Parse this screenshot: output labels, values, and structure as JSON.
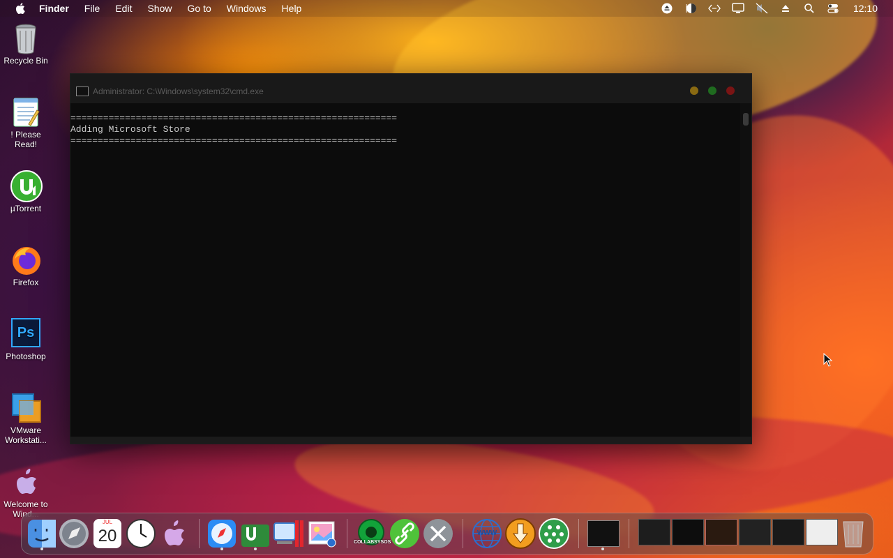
{
  "menubar": {
    "app": "Finder",
    "items": [
      "File",
      "Edit",
      "Show",
      "Go to",
      "Windows",
      "Help"
    ],
    "status_icons": [
      "eject-circle-icon",
      "half-moon-icon",
      "code-arrows-icon",
      "display-icon",
      "mute-icon",
      "eject-icon",
      "search-icon",
      "control-center-icon"
    ],
    "clock": "12:10"
  },
  "desktop": {
    "icons": [
      {
        "label": "Recycle Bin",
        "icon": "recycle-bin-icon"
      },
      {
        "label": "! Please Read!",
        "icon": "notepad-icon"
      },
      {
        "label": "µTorrent",
        "icon": "utorrent-icon"
      },
      {
        "label": "Firefox",
        "icon": "firefox-icon"
      },
      {
        "label": "Photoshop",
        "icon": "photoshop-icon",
        "glyph": "Ps"
      },
      {
        "label": "VMware Workstati...",
        "icon": "vmware-icon"
      },
      {
        "label": "Welcome to Wind...",
        "icon": "welcome-icon"
      }
    ]
  },
  "cmd": {
    "title": "Administrator: C:\\Windows\\system32\\cmd.exe",
    "lines": [
      "============================================================",
      "Adding Microsoft Store",
      "============================================================"
    ]
  },
  "dock": {
    "calendar": {
      "month": "JUL",
      "day": "20"
    },
    "collab_label": "COLLABSYSOS",
    "www_label": "WWW"
  },
  "colors": {
    "traffic_yellow": "#8a6a12",
    "traffic_green": "#1f6b1f",
    "traffic_red": "#7a1414",
    "terminal_bg": "#0c0c0c",
    "terminal_text": "#cccccc"
  }
}
